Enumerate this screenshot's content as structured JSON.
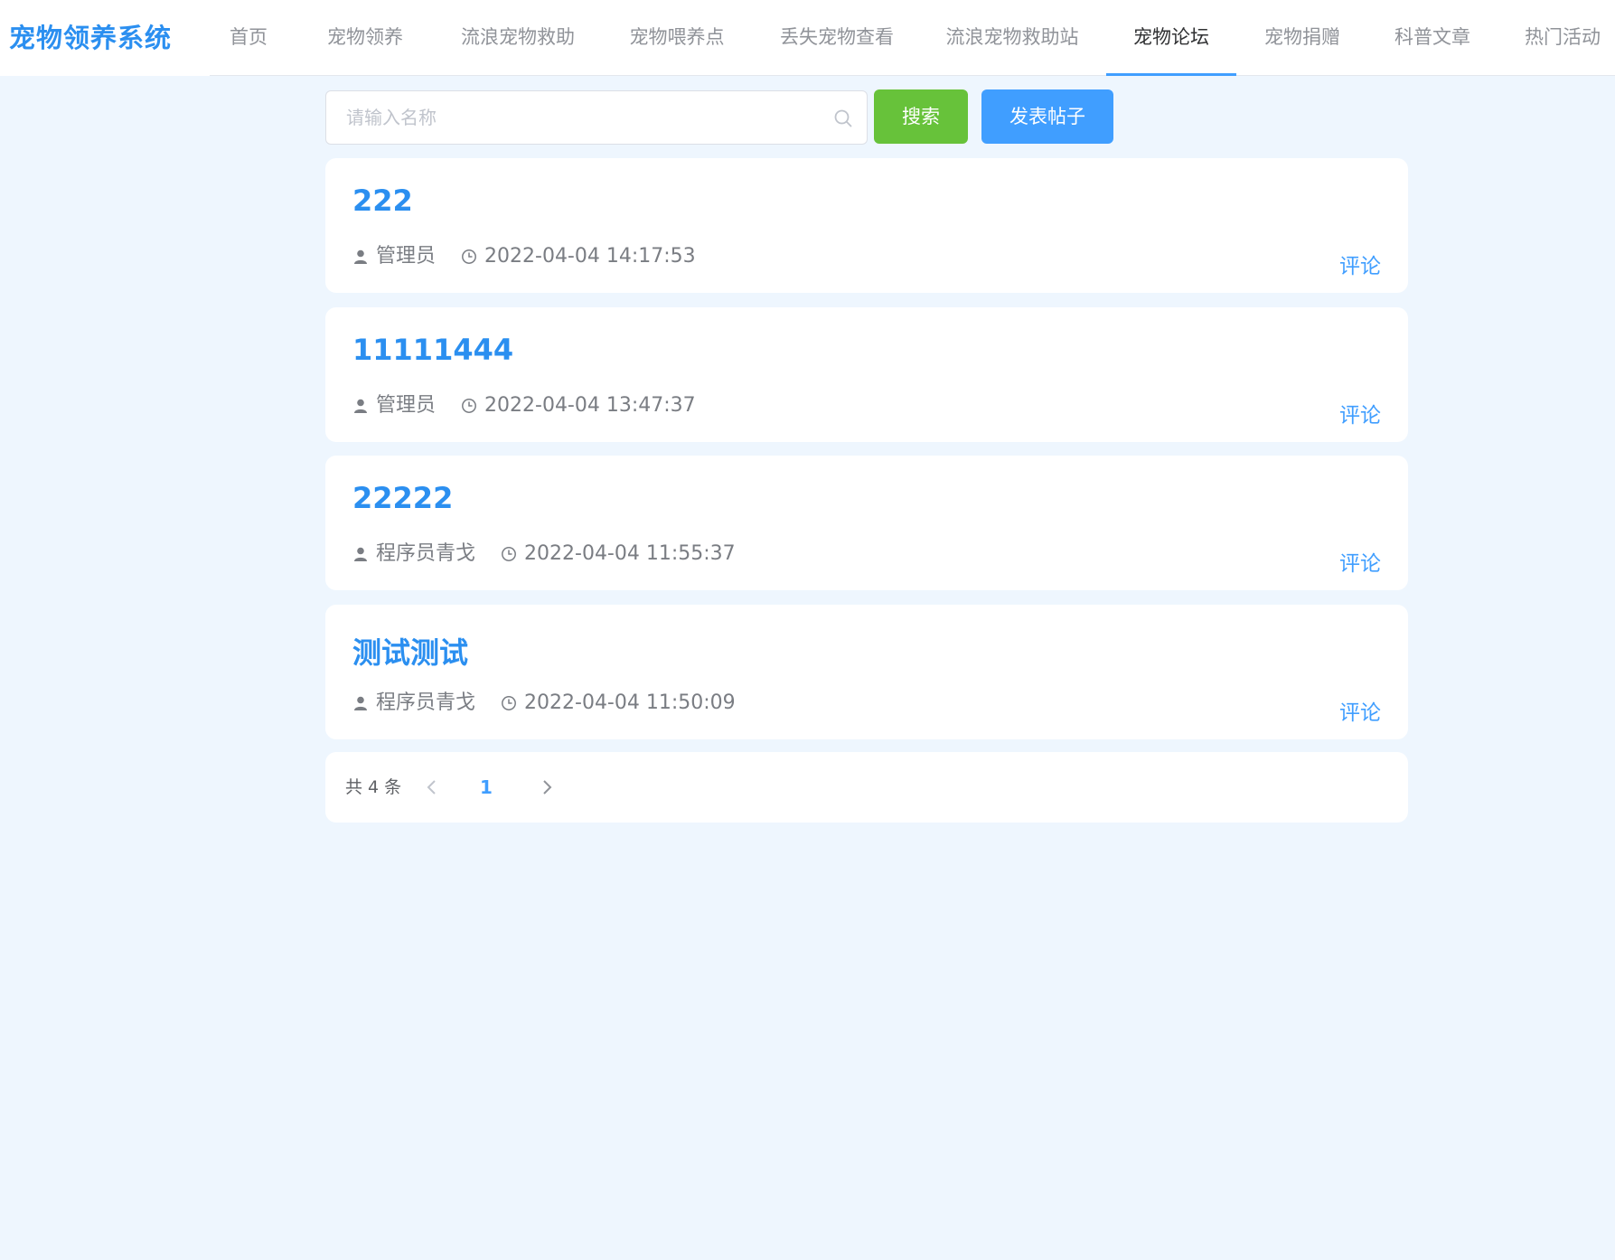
{
  "header": {
    "brand": "宠物领养系统",
    "nav": [
      {
        "label": "首页",
        "active": false
      },
      {
        "label": "宠物领养",
        "active": false
      },
      {
        "label": "流浪宠物救助",
        "active": false
      },
      {
        "label": "宠物喂养点",
        "active": false
      },
      {
        "label": "丢失宠物查看",
        "active": false
      },
      {
        "label": "流浪宠物救助站",
        "active": false
      },
      {
        "label": "宠物论坛",
        "active": true
      },
      {
        "label": "宠物捐赠",
        "active": false
      },
      {
        "label": "科普文章",
        "active": false
      },
      {
        "label": "热门活动",
        "active": false
      }
    ]
  },
  "search": {
    "placeholder": "请输入名称",
    "value": "",
    "search_label": "搜索",
    "post_label": "发表帖子"
  },
  "posts": [
    {
      "title": "222",
      "author": "管理员",
      "time": "2022-04-04 14:17:53",
      "comment_label": "评论"
    },
    {
      "title": "11111444",
      "author": "管理员",
      "time": "2022-04-04 13:47:37",
      "comment_label": "评论"
    },
    {
      "title": "22222",
      "author": "程序员青戈",
      "time": "2022-04-04 11:55:37",
      "comment_label": "评论"
    },
    {
      "title": "测试测试",
      "author": "程序员青戈",
      "time": "2022-04-04 11:50:09",
      "comment_label": "评论"
    }
  ],
  "pagination": {
    "total_text": "共 4 条",
    "current_page": "1"
  },
  "icons": {
    "search": "search-icon",
    "user": "user-icon",
    "clock": "clock-icon",
    "prev": "chevron-left-icon",
    "next": "chevron-right-icon"
  },
  "colors": {
    "accent": "#409eff",
    "brand": "#2b8ff0",
    "search_button": "#67c23a",
    "page_background": "#eef6fe"
  }
}
